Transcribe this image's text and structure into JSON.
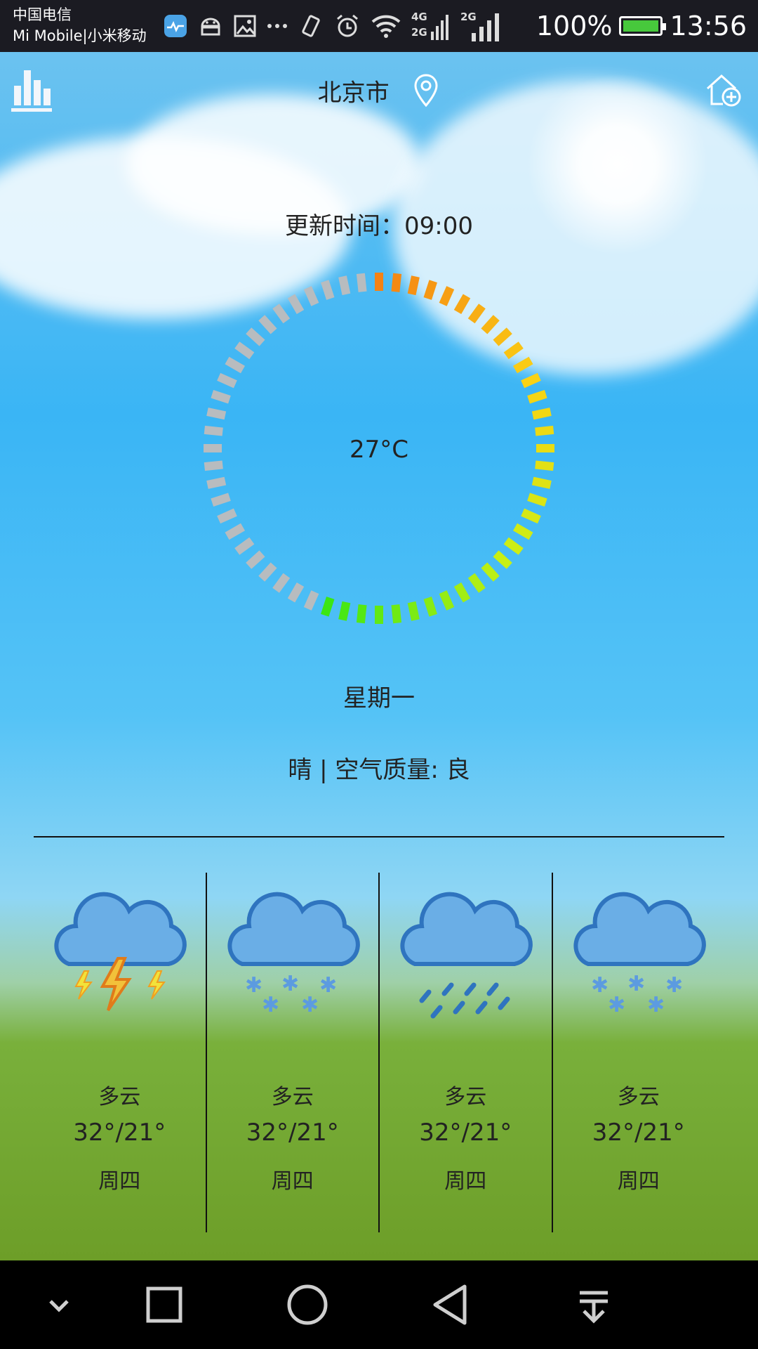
{
  "status_bar": {
    "carrier_line1": "中国电信",
    "carrier_line2": "Mi Mobile|小米移动",
    "network_4g": "4G",
    "network_2g_a": "2G",
    "network_2g_b": "2G",
    "battery_text": "100%",
    "time": "13:56",
    "battery_level": 1.0,
    "battery_color": "#47c83c"
  },
  "header": {
    "city": "北京市",
    "chart_icon": "bar-chart-icon",
    "location_icon": "location-pin-icon",
    "add_icon": "add-city-icon"
  },
  "current": {
    "update_label": "更新时间：09:00",
    "temperature": "27°C",
    "weekday": "星期一",
    "condition": "晴 | 空气质量: 良",
    "gauge_fraction": 0.56
  },
  "forecast": [
    {
      "icon": "thunderstorm-icon",
      "desc": "多云",
      "range": "32°/21°",
      "day": "周四"
    },
    {
      "icon": "snow-icon",
      "desc": "多云",
      "range": "32°/21°",
      "day": "周四"
    },
    {
      "icon": "rain-icon",
      "desc": "多云",
      "range": "32°/21°",
      "day": "周四"
    },
    {
      "icon": "snow-icon",
      "desc": "多云",
      "range": "32°/21°",
      "day": "周四"
    }
  ],
  "nav_bar": {
    "items": [
      "chevron-down-icon",
      "recent-apps-icon",
      "home-circle-icon",
      "back-triangle-icon",
      "pull-down-icon"
    ]
  }
}
